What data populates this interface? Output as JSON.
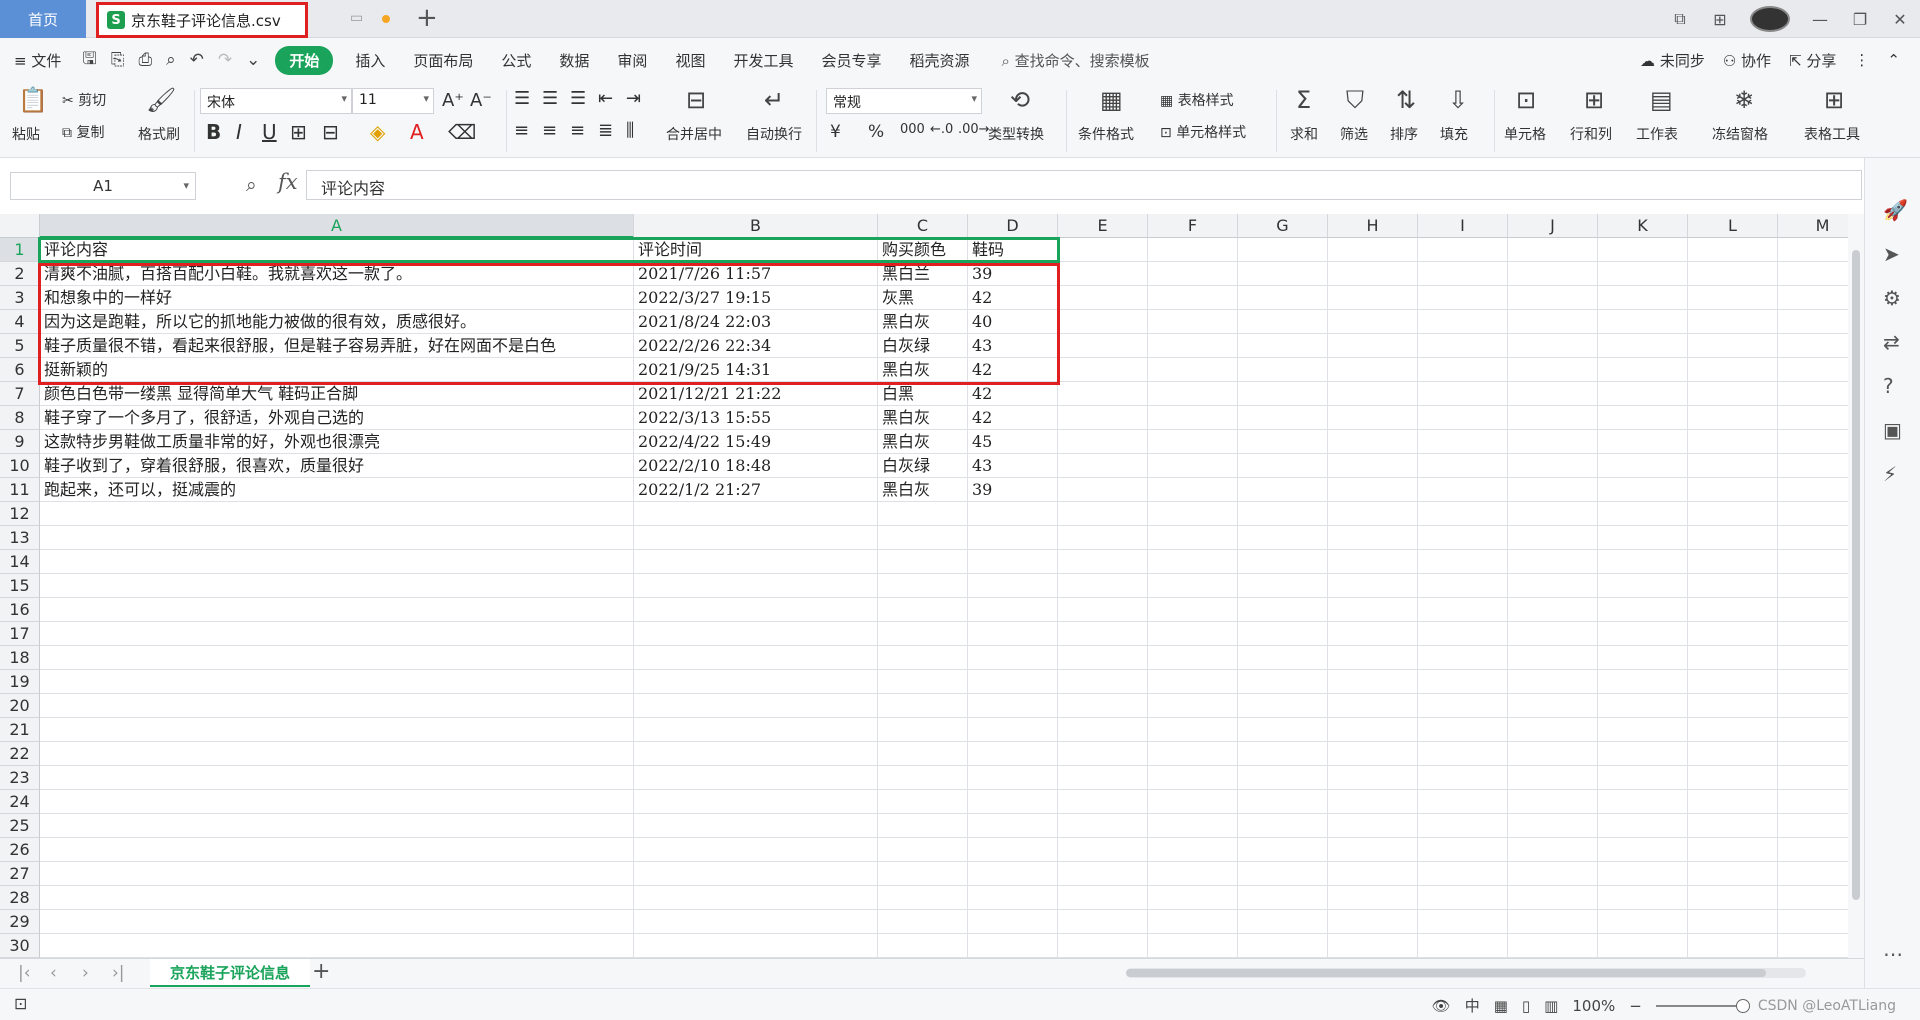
{
  "titlebar": {
    "home_tab": "首页",
    "doc_tab": "京东鞋子评论信息.csv",
    "doc_icon": "S",
    "new_tab": "+"
  },
  "menu": {
    "file": "文件",
    "tabs": [
      "开始",
      "插入",
      "页面布局",
      "公式",
      "数据",
      "审阅",
      "视图",
      "开发工具",
      "会员专享",
      "稻壳资源"
    ],
    "search_cmd": "查找命令、搜索模板",
    "unsynced": "未同步",
    "collaborate": "协作",
    "share": "分享"
  },
  "ribbon": {
    "paste": "粘贴",
    "cut": "剪切",
    "copy": "复制",
    "format_painter": "格式刷",
    "font_name": "宋体",
    "font_size": "11",
    "merge_center": "合并居中",
    "wrap_text": "自动换行",
    "number_format": "常规",
    "type_convert": "类型转换",
    "conditional_format": "条件格式",
    "table_style": "表格样式",
    "cell_style": "单元格样式",
    "sum": "求和",
    "filter": "筛选",
    "sort": "排序",
    "fill": "填充",
    "cell": "单元格",
    "row_col": "行和列",
    "worksheet": "工作表",
    "freeze": "冻结窗格",
    "table_tools": "表格工具",
    "bold": "B",
    "italic": "I",
    "underline": "U",
    "currency": "¥",
    "percent": "%",
    "thousands": "000"
  },
  "formula_bar": {
    "name_box": "A1",
    "fx_label": "fx",
    "formula": "评论内容"
  },
  "columns": [
    "A",
    "B",
    "C",
    "D",
    "E",
    "F",
    "G",
    "H",
    "I",
    "J",
    "K",
    "L",
    "M"
  ],
  "row_numbers": [
    "1",
    "2",
    "3",
    "4",
    "5",
    "6",
    "7",
    "8",
    "9",
    "10",
    "11",
    "12",
    "13",
    "14",
    "15",
    "16",
    "17",
    "18",
    "19",
    "20",
    "21",
    "22",
    "23",
    "24",
    "25",
    "26",
    "27",
    "28",
    "29",
    "30"
  ],
  "sheet": {
    "header": [
      "评论内容",
      "评论时间",
      "购买颜色",
      "鞋码"
    ],
    "rows": [
      [
        "清爽不油腻，百搭百配小白鞋。我就喜欢这一款了。",
        "2021/7/26 11:57",
        "黑白兰",
        "39"
      ],
      [
        "和想象中的一样好",
        "2022/3/27 19:15",
        "灰黑",
        "42"
      ],
      [
        "因为这是跑鞋，所以它的抓地能力被做的很有效，质感很好。",
        "2021/8/24 22:03",
        "黑白灰",
        "40"
      ],
      [
        "鞋子质量很不错，看起来很舒服，但是鞋子容易弄脏，好在网面不是白色",
        "2022/2/26 22:34",
        "白灰绿",
        "43"
      ],
      [
        "挺新颖的",
        "2021/9/25 14:31",
        "黑白灰",
        "42"
      ],
      [
        "颜色白色带一缕黑 显得简单大气 鞋码正合脚",
        "2021/12/21 21:22",
        "白黑",
        "42"
      ],
      [
        "鞋子穿了一个多月了，很舒适，外观自己选的",
        "2022/3/13 15:55",
        "黑白灰",
        "42"
      ],
      [
        "这款特步男鞋做工质量非常的好，外观也很漂亮",
        "2022/4/22 15:49",
        "黑白灰",
        "45"
      ],
      [
        "鞋子收到了，穿着很舒服，很喜欢，质量很好",
        "2022/2/10 18:48",
        "白灰绿",
        "43"
      ],
      [
        "跑起来，还可以，挺减震的",
        "2022/1/2 21:27",
        "黑白灰",
        "39"
      ]
    ]
  },
  "sheet_tab": "京东鞋子评论信息",
  "status": {
    "zoom": "100%",
    "watermark": "CSDN @LeoATLiang"
  },
  "colors": {
    "accent_green": "#1aa35a",
    "highlight_red": "#e02020",
    "home_tab_blue": "#5b8fd6"
  }
}
